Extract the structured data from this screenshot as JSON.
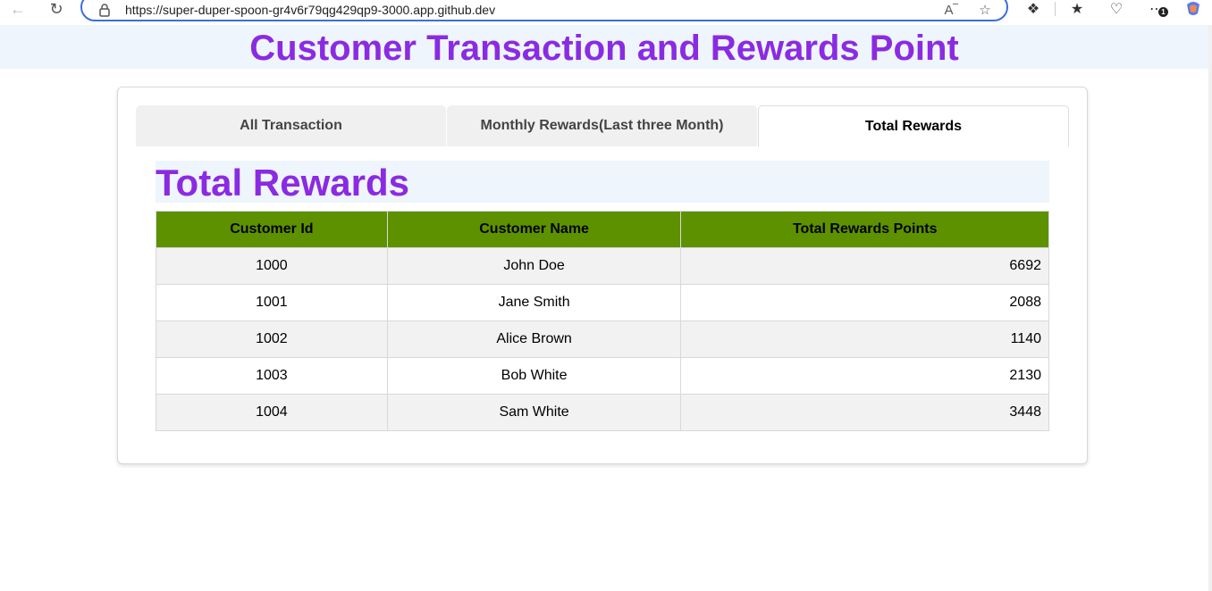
{
  "browser": {
    "url": "https://super-duper-spoon-gr4v6r79qg429qp9-3000.app.github.dev",
    "notification_count": "1"
  },
  "page": {
    "title": "Customer Transaction and Rewards Point"
  },
  "tabs": [
    {
      "label": "All Transaction"
    },
    {
      "label": "Monthly Rewards(Last three Month)"
    },
    {
      "label": "Total Rewards"
    }
  ],
  "section": {
    "title": "Total Rewards"
  },
  "table": {
    "headers": [
      "Customer Id",
      "Customer Name",
      "Total Rewards Points"
    ],
    "rows": [
      {
        "id": "1000",
        "name": "John Doe",
        "points": "6692"
      },
      {
        "id": "1001",
        "name": "Jane Smith",
        "points": "2088"
      },
      {
        "id": "1002",
        "name": "Alice Brown",
        "points": "1140"
      },
      {
        "id": "1003",
        "name": "Bob White",
        "points": "2130"
      },
      {
        "id": "1004",
        "name": "Sam White",
        "points": "3448"
      }
    ]
  },
  "colors": {
    "title": "#8a2be2",
    "header_bg": "#eef5fc",
    "table_header": "#5e9100"
  }
}
